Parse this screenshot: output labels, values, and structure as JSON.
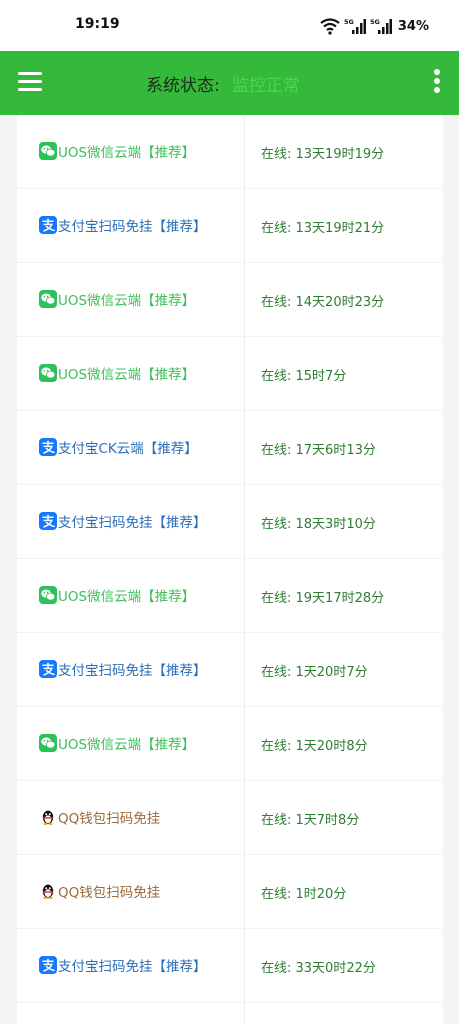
{
  "status_bar": {
    "time": "19:19",
    "network_1": "5G",
    "network_2": "5G",
    "battery": "34%",
    "icons": [
      "wifi-icon",
      "signal-icon",
      "signal-icon",
      "battery-text"
    ]
  },
  "app_bar": {
    "menu_icon": "hamburger-menu-icon",
    "title_label": "系统状态:",
    "title_value": "监控正常",
    "more_icon": "more-vertical-icon",
    "colors": {
      "background": "#35b93a",
      "title_value": "#49d84c"
    }
  },
  "colors": {
    "wechat_text": "#3cbf5a",
    "alipay_text": "#2b6eb8",
    "qq_text": "#9a6a3a",
    "status_text": "#2e7d32"
  },
  "rows": [
    {
      "type": "wechat",
      "icon": "wechat-icon",
      "name": "UOS微信云端【推荐】",
      "status": "在线: 13天19时19分"
    },
    {
      "type": "alipay",
      "icon": "alipay-icon",
      "name": "支付宝扫码免挂【推荐】",
      "status": "在线: 13天19时21分"
    },
    {
      "type": "wechat",
      "icon": "wechat-icon",
      "name": "UOS微信云端【推荐】",
      "status": "在线: 14天20时23分"
    },
    {
      "type": "wechat",
      "icon": "wechat-icon",
      "name": "UOS微信云端【推荐】",
      "status": "在线: 15时7分"
    },
    {
      "type": "alipay",
      "icon": "alipay-icon",
      "name": "支付宝CK云端【推荐】",
      "status": "在线: 17天6时13分"
    },
    {
      "type": "alipay",
      "icon": "alipay-icon",
      "name": "支付宝扫码免挂【推荐】",
      "status": "在线: 18天3时10分"
    },
    {
      "type": "wechat",
      "icon": "wechat-icon",
      "name": "UOS微信云端【推荐】",
      "status": "在线: 19天17时28分"
    },
    {
      "type": "alipay",
      "icon": "alipay-icon",
      "name": "支付宝扫码免挂【推荐】",
      "status": "在线: 1天20时7分"
    },
    {
      "type": "wechat",
      "icon": "wechat-icon",
      "name": "UOS微信云端【推荐】",
      "status": "在线: 1天20时8分"
    },
    {
      "type": "qq",
      "icon": "qq-penguin-icon",
      "name": "QQ钱包扫码免挂",
      "status": "在线: 1天7时8分"
    },
    {
      "type": "qq",
      "icon": "qq-penguin-icon",
      "name": "QQ钱包扫码免挂",
      "status": "在线: 1时20分"
    },
    {
      "type": "alipay",
      "icon": "alipay-icon",
      "name": "支付宝扫码免挂【推荐】",
      "status": "在线: 33天0时22分"
    }
  ]
}
